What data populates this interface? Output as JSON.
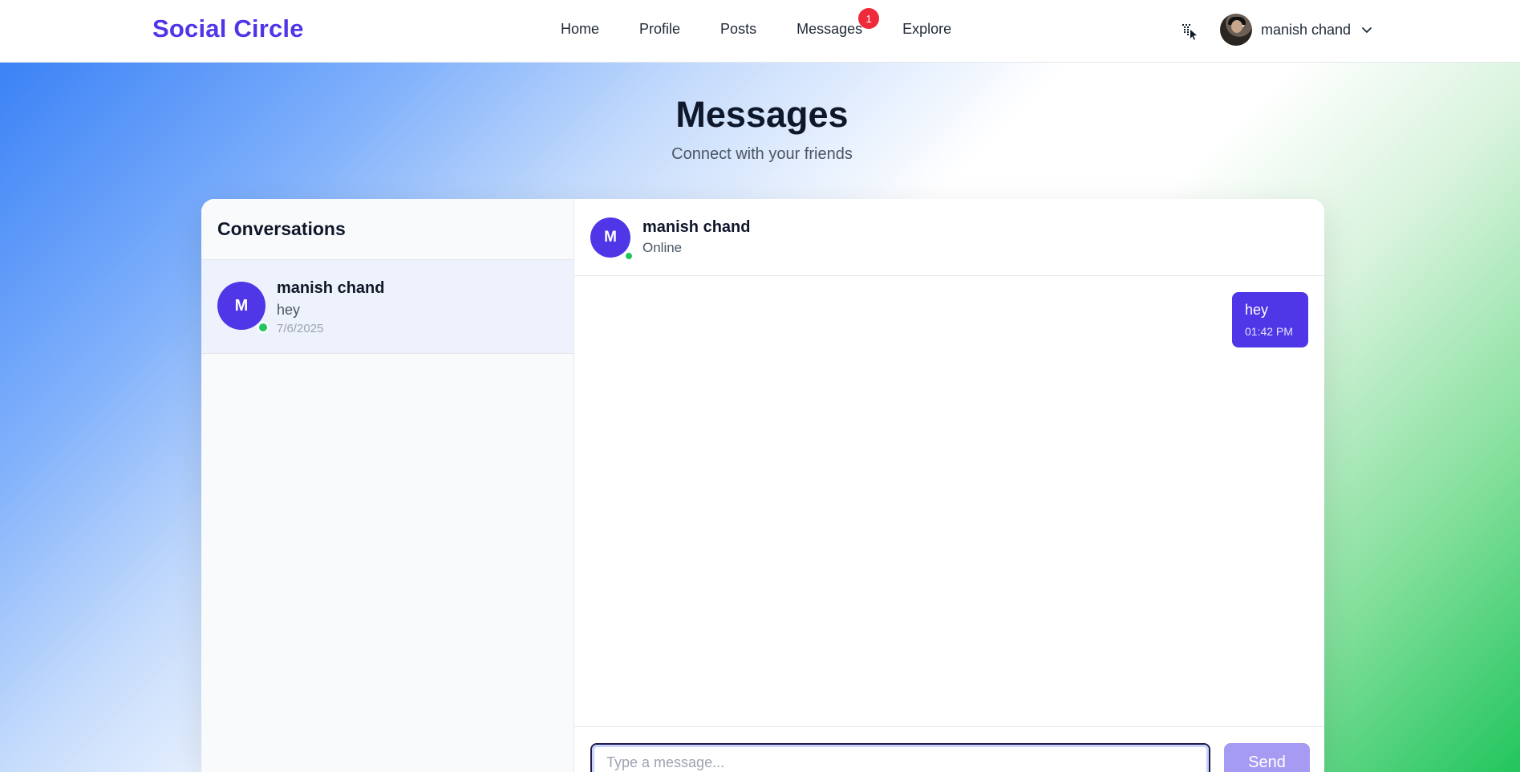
{
  "app": {
    "brand": "Social Circle",
    "brand_color": "#4f36e6"
  },
  "nav": {
    "links": [
      {
        "label": "Home"
      },
      {
        "label": "Profile"
      },
      {
        "label": "Posts"
      },
      {
        "label": "Messages",
        "badge": "1"
      },
      {
        "label": "Explore"
      }
    ],
    "translate_icon": "translate-icon",
    "user": {
      "name": "manish chand",
      "menu_icon": "chevron-down-icon"
    }
  },
  "page": {
    "title": "Messages",
    "subtitle": "Connect with your friends"
  },
  "conversations": {
    "title": "Conversations",
    "items": [
      {
        "avatar_initial": "M",
        "name": "manish chand",
        "last_message": "hey",
        "date": "7/6/2025",
        "online": true
      }
    ]
  },
  "chat": {
    "avatar_initial": "M",
    "name": "manish chand",
    "status": "Online",
    "messages": [
      {
        "text": "hey",
        "time": "01:42 PM",
        "outgoing": true
      }
    ],
    "composer": {
      "placeholder": "Type a message...",
      "value": "",
      "send_label": "Send"
    }
  },
  "colors": {
    "accent": "#4f36e6",
    "online": "#22c55e",
    "badge": "#ef2b3a",
    "send_disabled": "#a59bf3"
  }
}
